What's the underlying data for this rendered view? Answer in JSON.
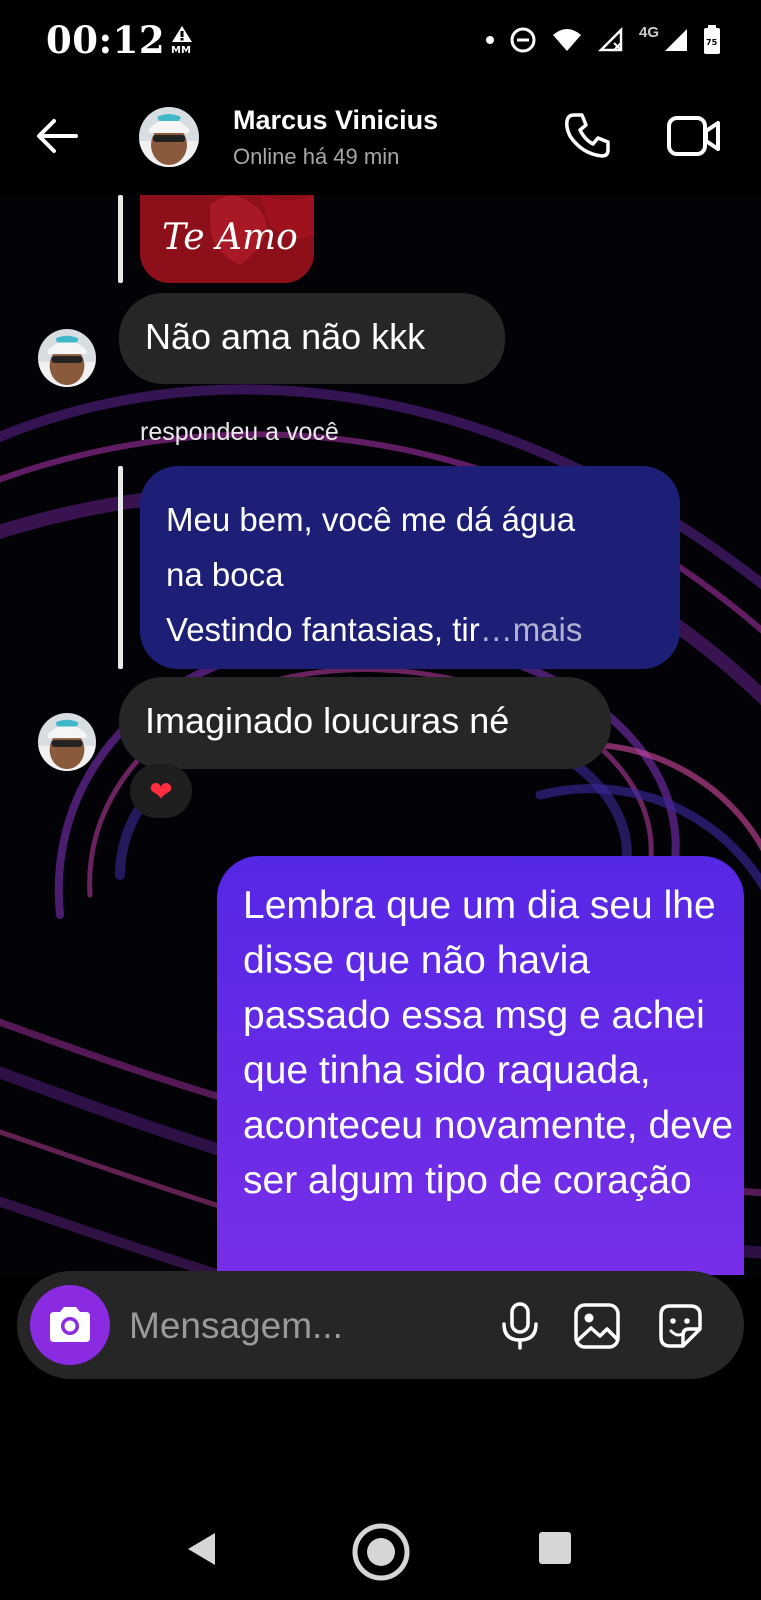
{
  "status_bar": {
    "time": "00:12",
    "network": "4G",
    "battery": "75"
  },
  "header": {
    "contact_name": "Marcus Vinicius",
    "contact_status": "Online há 49 min"
  },
  "messages": {
    "sticker_text": "Te Amo",
    "incoming_1": "Não ama não kkk",
    "reply_caption": "respondeu a você",
    "quoted_line1": "Meu bem, você me dá água",
    "quoted_line2": "na boca",
    "quoted_line3": "Vestindo fantasias, tir",
    "quoted_more": "…mais",
    "incoming_2": "Imaginado loucuras né",
    "reaction": "❤",
    "outgoing": "Lembra que um dia seu lhe disse que não havia passado essa msg e achei que tinha sido raquada, aconteceu novamente, deve ser algum tipo de coração"
  },
  "composer": {
    "placeholder": "Mensagem..."
  },
  "colors": {
    "incoming_bubble": "#262626",
    "quoted_bubble": "#1d1f77",
    "outgoing_top": "#5528e6",
    "outgoing_bottom": "#7a2fe8",
    "camera_button": "#8a2be2"
  }
}
